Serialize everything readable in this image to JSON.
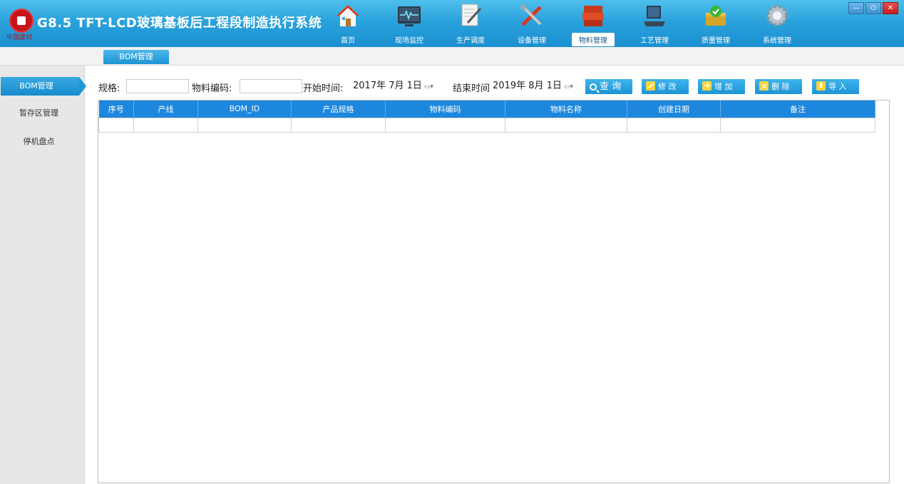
{
  "app": {
    "title": "G8.5 TFT-LCD玻璃基板后工程段制造执行系统",
    "logo_text": "中国建材"
  },
  "nav": [
    {
      "label": "首页",
      "icon": "home-icon"
    },
    {
      "label": "现场监控",
      "icon": "monitor-icon"
    },
    {
      "label": "生产调度",
      "icon": "schedule-icon"
    },
    {
      "label": "设备管理",
      "icon": "tools-icon"
    },
    {
      "label": "物料管理",
      "icon": "materials-icon",
      "active": true
    },
    {
      "label": "工艺管理",
      "icon": "laptop-icon"
    },
    {
      "label": "质量管理",
      "icon": "quality-icon"
    },
    {
      "label": "系统管理",
      "icon": "gear-icon"
    }
  ],
  "window": {
    "minimize": "—",
    "power": "⏻",
    "close": "✕"
  },
  "subtab": {
    "label": "BOM管理"
  },
  "sidebar": {
    "items": [
      {
        "label": "BOM管理"
      },
      {
        "label": "暂存区管理"
      },
      {
        "label": "停机盘点"
      }
    ]
  },
  "filters": {
    "spec_label": "规格:",
    "spec_value": "",
    "code_label": "物料编码:",
    "code_value": "",
    "start_label": "开始时间:",
    "start_value": "2017年 7月 1日",
    "end_label": "结束时间:",
    "end_value": "2019年 8月 1日"
  },
  "actions": {
    "query": "查 询",
    "edit": "修 改",
    "add": "增 加",
    "delete": "删 除",
    "import": "导 入"
  },
  "table": {
    "headers": [
      "序号",
      "产线",
      "BOM_ID",
      "产品规格",
      "物料编码",
      "物料名称",
      "创建日期",
      "备注"
    ]
  },
  "colors": {
    "header_blue": "#2aa2dc",
    "accent": "#1c87dd",
    "button_icon": "#ffd33b",
    "logo_red": "#c7141a"
  }
}
